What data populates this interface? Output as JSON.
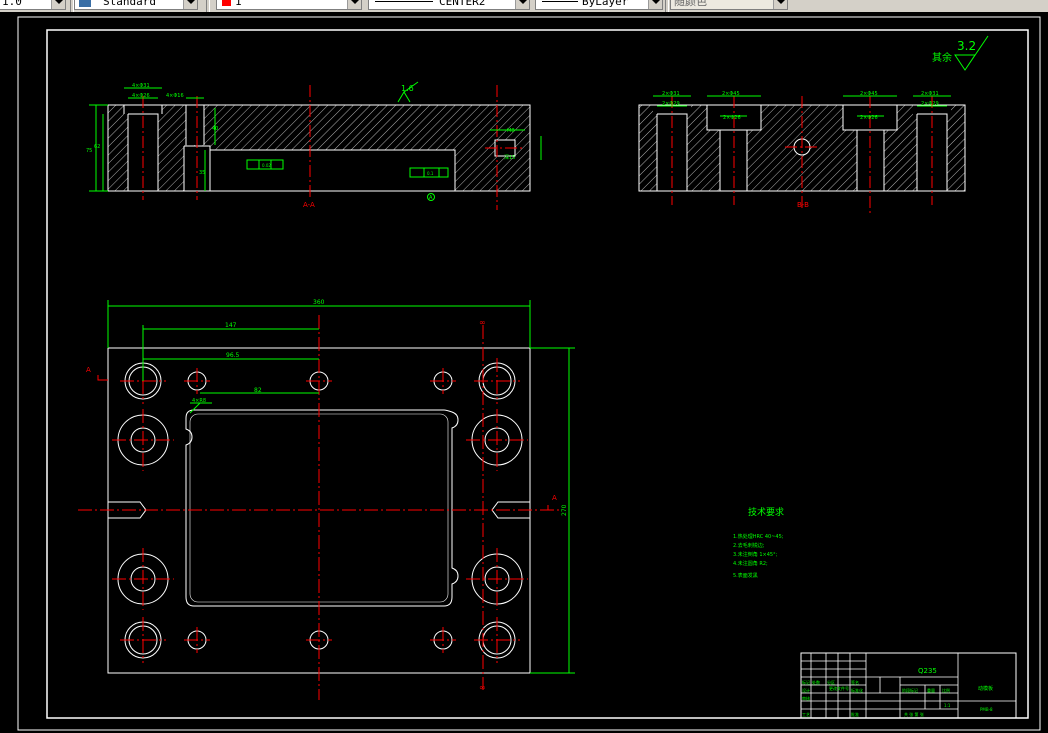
{
  "toolbar": {
    "combo_1": "1.0",
    "text_style": "Standard",
    "color": "1",
    "linetype": "CENTER2",
    "lineweight": "ByLayer",
    "plot_style": "随颜色"
  },
  "drawing": {
    "roughness_default": "其余",
    "roughness_value": "3.2",
    "section_aa": "A-A",
    "section_bb": "B-B",
    "section_mark": "A",
    "roughness_top": "1.6",
    "datum": "A",
    "dim_width": "360",
    "dim_147": "147",
    "dim_96": "96.5",
    "dim_82": "82",
    "dim_height": "270",
    "dim_r": "4×R8",
    "dim_aa_1": "4×Φ31",
    "dim_aa_2": "4×Φ26",
    "dim_aa_3": "4×Φ16",
    "dim_bb_1": "2×Φ31",
    "dim_bb_2": "2×Φ29",
    "dim_bb_3": "2×Φ45",
    "dim_bb_4": "2×Φ26",
    "dim_bb_5": "2×Φ45",
    "dim_bb_6": "2×Φ26",
    "dim_bb_7": "2×Φ31",
    "dim_bb_8": "2×Φ29",
    "dim_aa_h1": "75",
    "dim_aa_h2": "62",
    "dim_aa_h3": "40",
    "dim_aa_h4": "35",
    "dim_aa_m": "M8",
    "dim_aa_depth": "深15",
    "tol_flat": "0.02",
    "tol_flat2": "0.1",
    "center_mark": "∞",
    "tech_title": "技术要求",
    "tech_req": [
      "1.热处理HRC 40~45;",
      "2.去毛刺锐边;",
      "3.未注倒角 1×45°;",
      "4.未注圆角 R2;",
      "5.表面发黑"
    ],
    "material": "Q235",
    "part_name": "动模板",
    "drawing_no": "PMB-8",
    "scale": "1:1",
    "title_block": {
      "r1": "标记",
      "r2": "处数",
      "r3": "分区",
      "r4": "更改文件号",
      "r5": "签名",
      "r6": "设计",
      "r7": "标准化",
      "r8": "审核",
      "r9": "工艺",
      "r10": "批准",
      "r11": "阶段标记",
      "r12": "重量",
      "r13": "比例",
      "r14": "共 张 第 张"
    }
  }
}
